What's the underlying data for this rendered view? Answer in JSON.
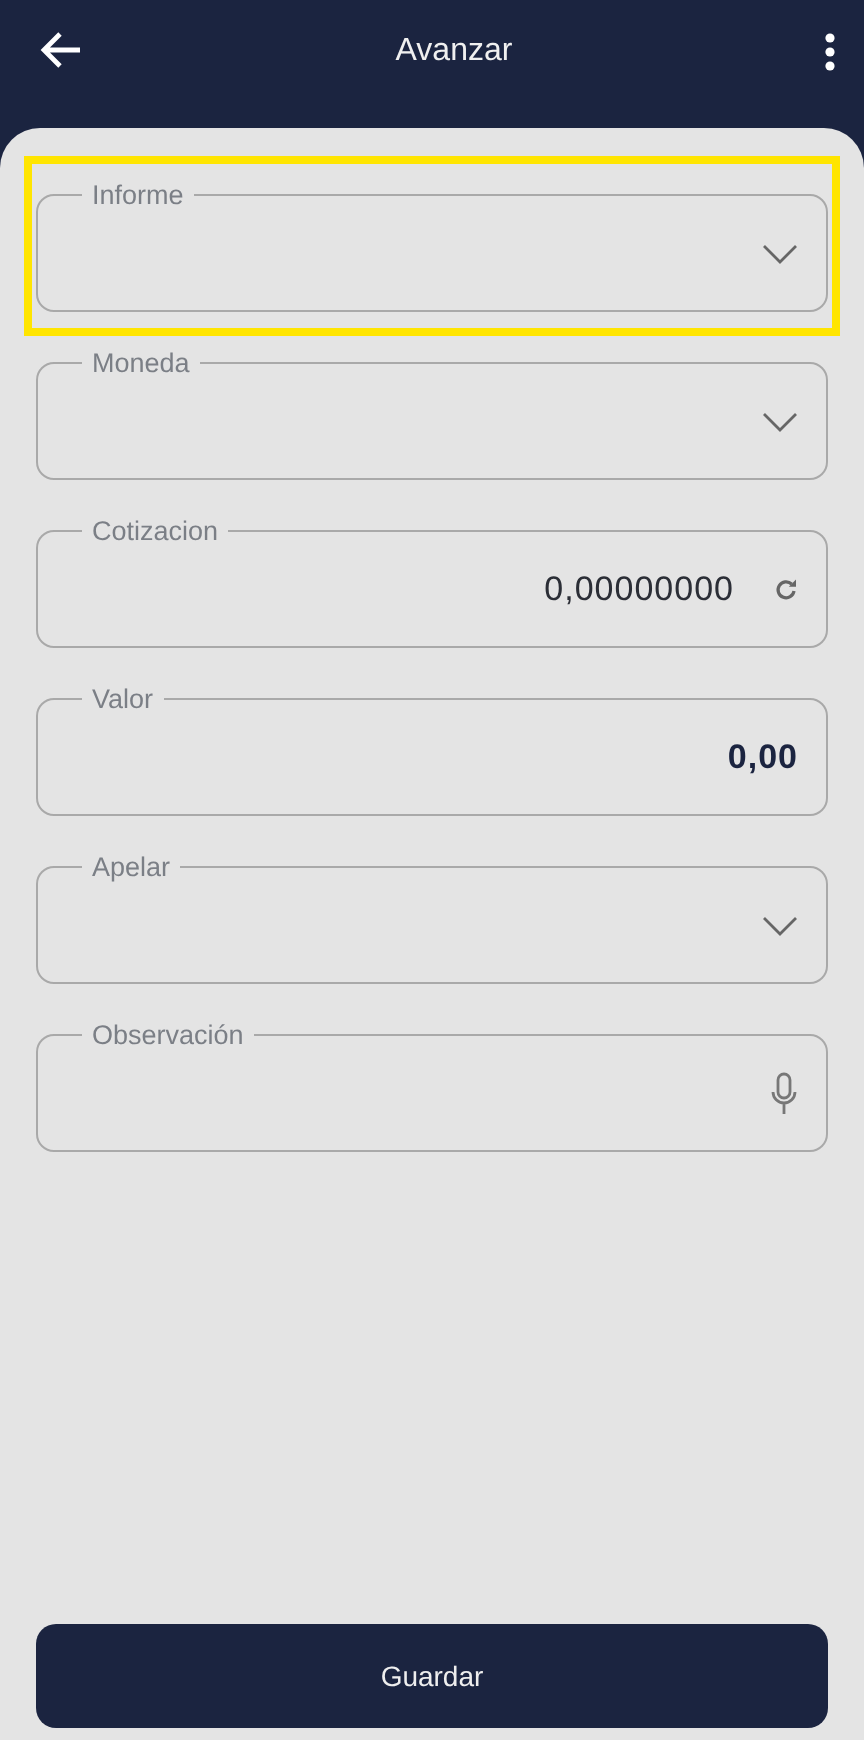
{
  "header": {
    "title": "Avanzar"
  },
  "fields": [
    {
      "label": "Informe",
      "kind": "select",
      "highlighted": true
    },
    {
      "label": "Moneda",
      "kind": "select",
      "highlighted": false
    },
    {
      "label": "Cotizacion",
      "kind": "rate",
      "value": "0,00000000",
      "highlighted": false
    },
    {
      "label": "Valor",
      "kind": "amount",
      "value": "0,00",
      "highlighted": false
    },
    {
      "label": "Apelar",
      "kind": "select",
      "highlighted": false
    },
    {
      "label": "Observación",
      "kind": "voice",
      "highlighted": false
    }
  ],
  "save_button": "Guardar"
}
